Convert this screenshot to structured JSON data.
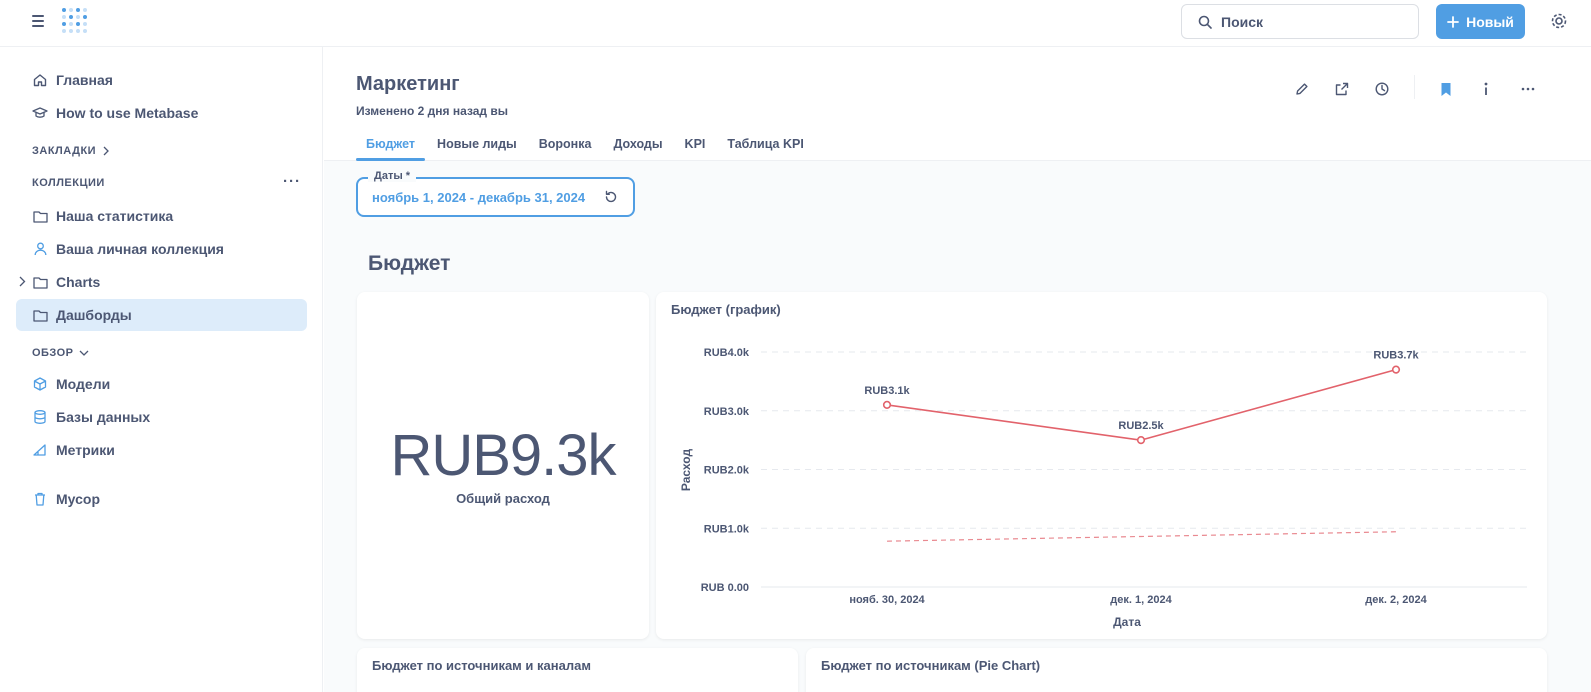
{
  "topbar": {
    "search_placeholder": "Поиск",
    "new_button": "Новый"
  },
  "sidebar": {
    "home": "Главная",
    "howto": "How to use Metabase",
    "bookmarks_header": "ЗАКЛАДКИ",
    "collections_header": "КОЛЛЕКЦИИ",
    "collections_more": "···",
    "collections": [
      "Наша статистика",
      "Ваша личная коллекция",
      "Charts",
      "Дашборды"
    ],
    "browse_header": "ОБЗОР",
    "browse": [
      "Модели",
      "Базы данных",
      "Метрики"
    ],
    "trash": "Мусор"
  },
  "dashboard": {
    "title": "Маркетинг",
    "subtitle": "Изменено 2 дня назад вы",
    "tabs": [
      "Бюджет",
      "Новые лиды",
      "Воронка",
      "Доходы",
      "KPI",
      "Таблица KPI"
    ],
    "active_tab": 0,
    "filter": {
      "label": "Даты *",
      "value": "ноябрь 1, 2024 - декабрь 31, 2024"
    },
    "section_title": "Бюджет",
    "scalar": {
      "value": "RUB9.3k",
      "caption": "Общий расход"
    },
    "bottom_cards": [
      "Бюджет по источникам и каналам",
      "Бюджет по источникам (Pie Chart)"
    ]
  },
  "colors": {
    "accent": "#509ee3",
    "series": "#e2626b",
    "text": "#4c5773"
  },
  "chart_data": {
    "type": "line",
    "title": "Бюджет (график)",
    "xlabel": "Дата",
    "ylabel": "Расход",
    "categories": [
      "нояб. 30, 2024",
      "дек. 1, 2024",
      "дек. 2, 2024"
    ],
    "yticks": [
      "RUB 0.00",
      "RUB1.0k",
      "RUB2.0k",
      "RUB3.0k",
      "RUB4.0k"
    ],
    "ylim": [
      0,
      4000
    ],
    "series": [
      {
        "values": [
          3100,
          2500,
          3700
        ],
        "labels": [
          "RUB3.1k",
          "RUB2.5k",
          "RUB3.7k"
        ],
        "style": "solid"
      },
      {
        "values": [
          780,
          860,
          940
        ],
        "style": "dashed"
      }
    ],
    "grid": true
  }
}
